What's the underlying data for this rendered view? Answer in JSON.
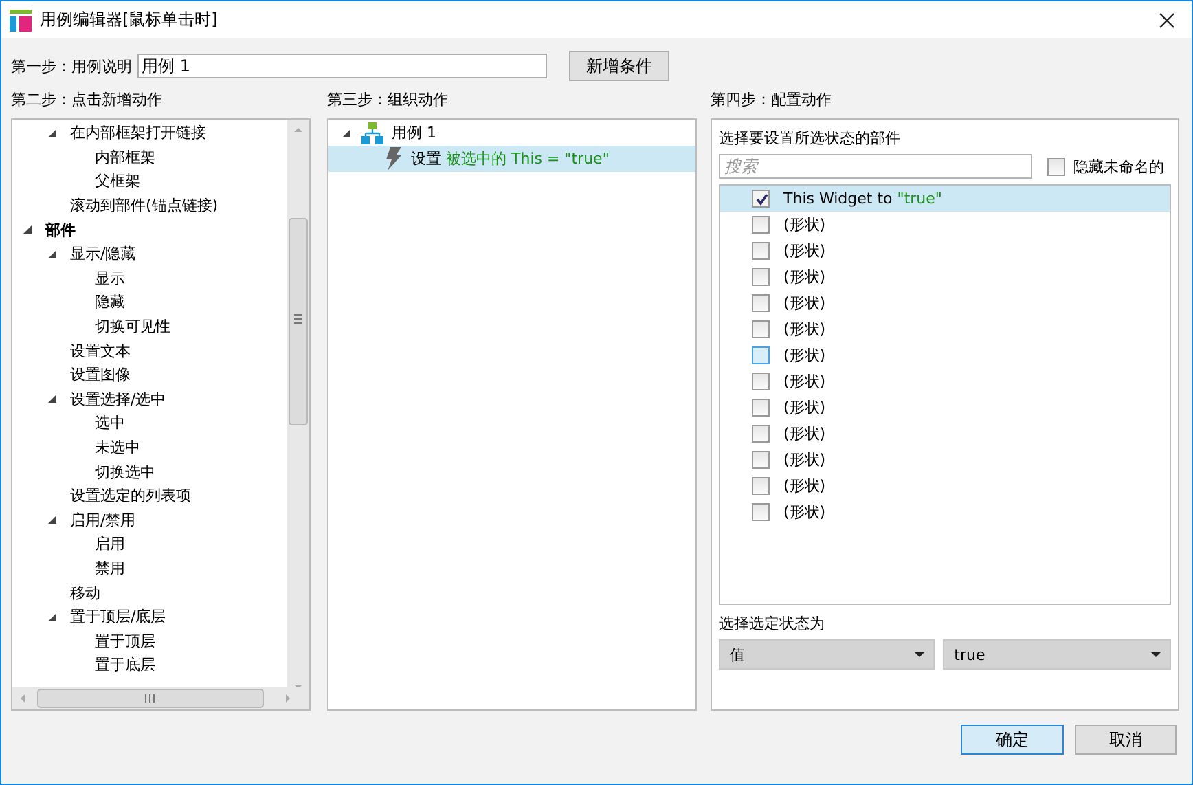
{
  "window": {
    "title": "用例编辑器[鼠标单击时]"
  },
  "step1": {
    "label": "第一步：用例说明",
    "value": "用例 1",
    "button": "新增条件"
  },
  "step2": {
    "label": "第二步：点击新增动作",
    "items": [
      {
        "label": "在内部框架打开链接",
        "kind": "action",
        "expanded": true,
        "children": [
          {
            "label": "内部框架",
            "kind": "action"
          },
          {
            "label": "父框架",
            "kind": "action"
          }
        ]
      },
      {
        "label": "滚动到部件(锚点链接)",
        "kind": "action"
      },
      {
        "label": "部件",
        "kind": "category",
        "expanded": true,
        "children": [
          {
            "label": "显示/隐藏",
            "kind": "action",
            "expanded": true,
            "children": [
              {
                "label": "显示",
                "kind": "action"
              },
              {
                "label": "隐藏",
                "kind": "action"
              },
              {
                "label": "切换可见性",
                "kind": "action"
              }
            ]
          },
          {
            "label": "设置文本",
            "kind": "action"
          },
          {
            "label": "设置图像",
            "kind": "action"
          },
          {
            "label": "设置选择/选中",
            "kind": "action",
            "expanded": true,
            "children": [
              {
                "label": "选中",
                "kind": "action"
              },
              {
                "label": "未选中",
                "kind": "action"
              },
              {
                "label": "切换选中",
                "kind": "action"
              }
            ]
          },
          {
            "label": "设置选定的列表项",
            "kind": "action"
          },
          {
            "label": "启用/禁用",
            "kind": "action",
            "expanded": true,
            "children": [
              {
                "label": "启用",
                "kind": "action"
              },
              {
                "label": "禁用",
                "kind": "action"
              }
            ]
          },
          {
            "label": "移动",
            "kind": "action"
          },
          {
            "label": "置于顶层/底层",
            "kind": "action",
            "expanded": true,
            "children": [
              {
                "label": "置于顶层",
                "kind": "action"
              },
              {
                "label": "置于底层",
                "kind": "action"
              }
            ]
          }
        ]
      }
    ]
  },
  "step3": {
    "label": "第三步：组织动作",
    "case": {
      "label": "用例 1",
      "expanded": true,
      "actions": [
        {
          "verb": "设置",
          "target": "被选中的 This = \"true\"",
          "selected": true
        }
      ]
    }
  },
  "step4": {
    "label": "第四步：配置动作",
    "heading": "选择要设置所选状态的部件",
    "search": {
      "placeholder": "搜索"
    },
    "hide_unnamed": {
      "label": "隐藏未命名的",
      "checked": false
    },
    "widgets": [
      {
        "label": "This Widget to",
        "value": "\"true\"",
        "checked": true,
        "selected": true,
        "hovered": false
      },
      {
        "label": "(形状)",
        "checked": false,
        "selected": false,
        "hovered": false
      },
      {
        "label": "(形状)",
        "checked": false,
        "selected": false,
        "hovered": false
      },
      {
        "label": "(形状)",
        "checked": false,
        "selected": false,
        "hovered": false
      },
      {
        "label": "(形状)",
        "checked": false,
        "selected": false,
        "hovered": false
      },
      {
        "label": "(形状)",
        "checked": false,
        "selected": false,
        "hovered": false
      },
      {
        "label": "(形状)",
        "checked": false,
        "selected": false,
        "hovered": true
      },
      {
        "label": "(形状)",
        "checked": false,
        "selected": false,
        "hovered": false
      },
      {
        "label": "(形状)",
        "checked": false,
        "selected": false,
        "hovered": false
      },
      {
        "label": "(形状)",
        "checked": false,
        "selected": false,
        "hovered": false
      },
      {
        "label": "(形状)",
        "checked": false,
        "selected": false,
        "hovered": false
      },
      {
        "label": "(形状)",
        "checked": false,
        "selected": false,
        "hovered": false
      },
      {
        "label": "(形状)",
        "checked": false,
        "selected": false,
        "hovered": false
      }
    ],
    "state_label": "选择选定状态为",
    "dropdowns": [
      {
        "value": "值"
      },
      {
        "value": "true"
      }
    ]
  },
  "buttons": [
    {
      "label": "确定",
      "default": true
    },
    {
      "label": "取消",
      "default": false
    }
  ]
}
